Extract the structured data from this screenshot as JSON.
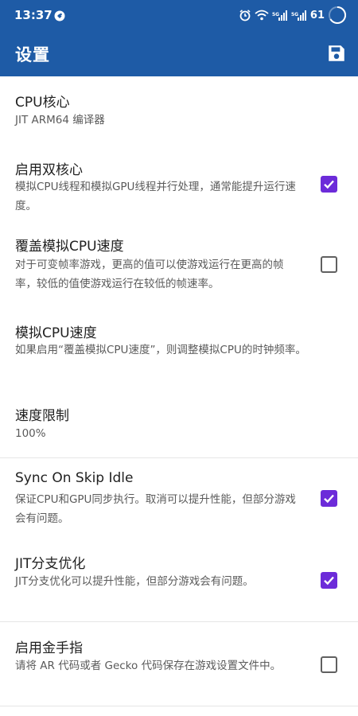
{
  "status_bar": {
    "time": "13:37",
    "battery": "61",
    "icons": [
      "notification-icon",
      "alarm-icon",
      "wifi-icon",
      "signal-icon",
      "signal-icon",
      "battery-icon"
    ]
  },
  "app_bar": {
    "title": "设置",
    "action_icon": "save-icon"
  },
  "colors": {
    "app_bar": "#1e5ba6",
    "checkbox_checked": "#6c2bd9",
    "divider": "#e6e6e6"
  },
  "settings": [
    {
      "title": "CPU核心",
      "summary": "JIT ARM64 编译器"
    },
    {
      "title": "启用双核心",
      "summary": "模拟CPU线程和模拟GPU线程并行处理，通常能提升运行速度。",
      "checked": true
    },
    {
      "title": "覆盖模拟CPU速度",
      "summary": "对于可变帧率游戏，更高的值可以使游戏运行在更高的帧率，较低的值使游戏运行在较低的帧速率。",
      "checked": false
    },
    {
      "title": "模拟CPU速度",
      "summary": "如果启用“覆盖模拟CPU速度”，则调整模拟CPU的时钟频率。"
    },
    {
      "title": "速度限制",
      "summary": "100%"
    },
    {
      "title": "Sync On Skip Idle",
      "summary": "保证CPU和GPU同步执行。取消可以提升性能，但部分游戏会有问题。",
      "checked": true
    },
    {
      "title": "JIT分支优化",
      "summary": "JIT分支优化可以提升性能，但部分游戏会有问题。",
      "checked": true
    },
    {
      "title": "启用金手指",
      "summary": "请将 AR 代码或者 Gecko 代码保存在游戏设置文件中。",
      "checked": false
    }
  ]
}
